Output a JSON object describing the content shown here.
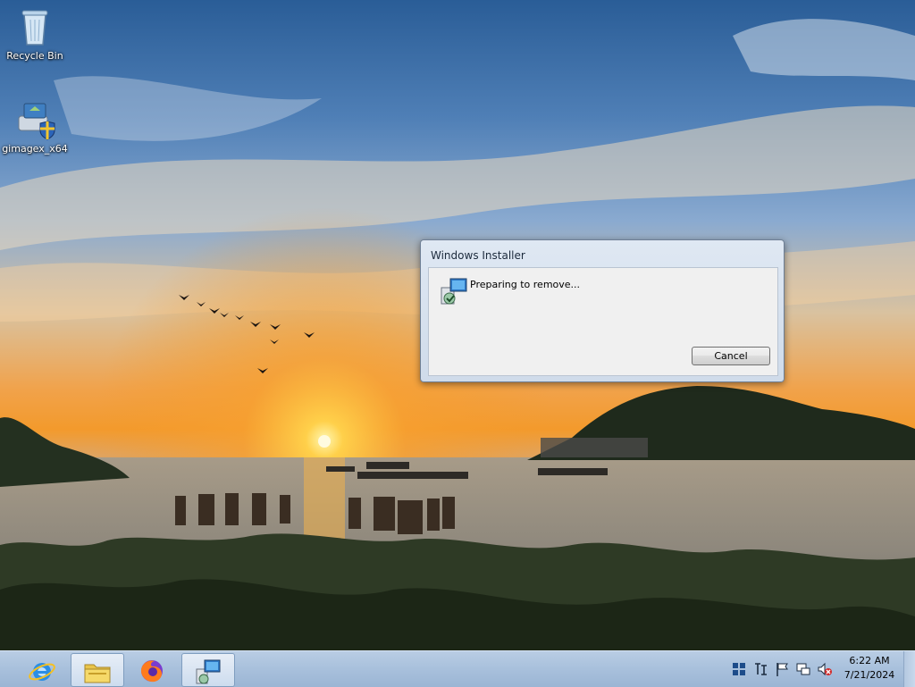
{
  "desktop": {
    "icons": [
      {
        "label": "Recycle Bin",
        "icon": "recycle-bin-icon"
      },
      {
        "label": "gimagex_x64",
        "icon": "installer-package-icon"
      }
    ]
  },
  "dialog": {
    "title": "Windows Installer",
    "message": "Preparing to remove...",
    "cancel_label": "Cancel",
    "icon": "windows-installer-icon"
  },
  "taskbar": {
    "items": [
      {
        "name": "internet-explorer",
        "icon": "internet-explorer-icon"
      },
      {
        "name": "file-explorer",
        "icon": "folder-icon"
      },
      {
        "name": "firefox",
        "icon": "firefox-icon"
      },
      {
        "name": "windows-installer",
        "icon": "windows-installer-icon",
        "active": true
      }
    ],
    "tray": [
      "action-center-icon",
      "input-method-icon",
      "flag-icon",
      "network-icon",
      "volume-muted-icon"
    ],
    "clock": {
      "time": "6:22 AM",
      "date": "7/21/2024"
    }
  },
  "colors": {
    "taskbar": "#a8c0dc",
    "dialog_frame": "#cfdbea",
    "accent": "#3b73b9"
  }
}
